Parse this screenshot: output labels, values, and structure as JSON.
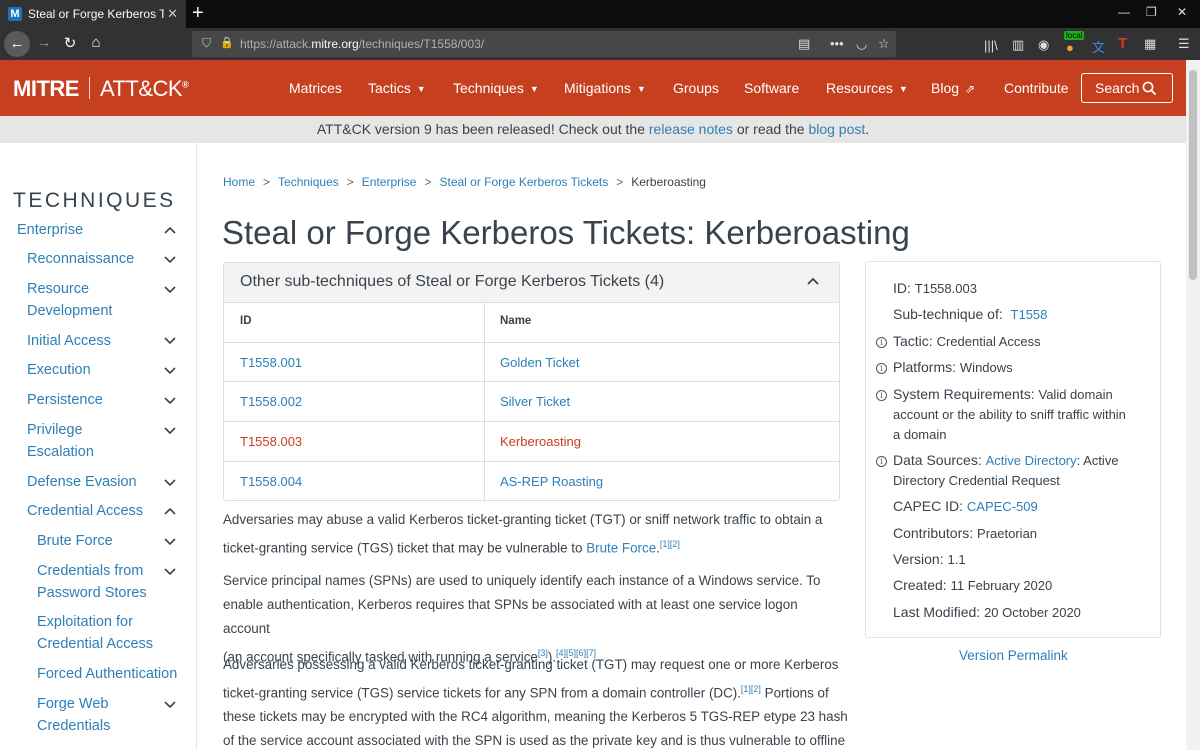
{
  "browser": {
    "tab_title": "Steal or Forge Kerberos Tickets",
    "tab_favicon": "M",
    "url_prefix": "https://attack.",
    "url_domain": "mitre.org",
    "url_path": "/techniques/T1558/003/",
    "local_badge": "local",
    "icons": [
      "back-icon",
      "forward-icon",
      "reload-icon",
      "home-icon",
      "shield-icon",
      "lock-icon",
      "reader-icon",
      "more-icon",
      "pocket-icon",
      "bookmark-star-icon",
      "library-icon",
      "sidebar-icon",
      "account-icon",
      "extension-icon",
      "translate-icon",
      "tab-icon",
      "grid-icon",
      "menu-icon"
    ]
  },
  "site": {
    "logo_mitre": "MITRE",
    "logo_attck": "ATT&CK",
    "logo_reg": "®",
    "nav": [
      {
        "label": "Matrices",
        "dropdown": false
      },
      {
        "label": "Tactics",
        "dropdown": true
      },
      {
        "label": "Techniques",
        "dropdown": true
      },
      {
        "label": "Mitigations",
        "dropdown": true
      },
      {
        "label": "Groups",
        "dropdown": false
      },
      {
        "label": "Software",
        "dropdown": false
      },
      {
        "label": "Resources",
        "dropdown": true
      },
      {
        "label": "Blog",
        "dropdown": false
      },
      {
        "label": "Contribute",
        "dropdown": false
      }
    ],
    "search_label": "Search",
    "header_color": "#c63f1f",
    "link_color": "#2e7fb8"
  },
  "banner": {
    "text_1": "ATT&CK version 9 has been released! Check out the ",
    "link_1": "release notes",
    "text_2": " or read the ",
    "link_2": "blog post",
    "text_3": "."
  },
  "sidebar": {
    "title": "TECHNIQUES",
    "items": [
      {
        "label": "Enterprise",
        "expanded": true
      },
      {
        "label": "Reconnaissance",
        "expanded": false
      },
      {
        "label": "Resource Development",
        "expanded": false
      },
      {
        "label": "Initial Access",
        "expanded": false
      },
      {
        "label": "Execution",
        "expanded": false
      },
      {
        "label": "Persistence",
        "expanded": false
      },
      {
        "label": "Privilege Escalation",
        "expanded": false
      },
      {
        "label": "Defense Evasion",
        "expanded": false
      },
      {
        "label": "Credential Access",
        "expanded": true
      },
      {
        "label": "Brute Force",
        "expanded": false
      },
      {
        "label": "Credentials from Password Stores",
        "expanded": false
      },
      {
        "label": "Exploitation for Credential Access"
      },
      {
        "label": "Forced Authentication"
      },
      {
        "label": "Forge Web Credentials",
        "expanded": false
      }
    ]
  },
  "breadcrumb": [
    "Home",
    "Techniques",
    "Enterprise",
    "Steal or Forge Kerberos Tickets",
    "Kerberoasting"
  ],
  "breadcrumb_sep": ">",
  "page_title": "Steal or Forge Kerberos Tickets: Kerberoasting",
  "subtechniques": {
    "heading": "Other sub-techniques of Steal or Forge Kerberos Tickets (4)",
    "col_id": "ID",
    "col_name": "Name",
    "rows": [
      {
        "id": "T1558.001",
        "name": "Golden Ticket",
        "active": false
      },
      {
        "id": "T1558.002",
        "name": "Silver Ticket",
        "active": false
      },
      {
        "id": "T1558.003",
        "name": "Kerberoasting",
        "active": true
      },
      {
        "id": "T1558.004",
        "name": "AS-REP Roasting",
        "active": false
      }
    ]
  },
  "description": {
    "p1_l1": "Adversaries may abuse a valid Kerberos ticket-granting ticket (TGT) or sniff network traffic to obtain a",
    "p1_l2": "ticket-granting service (TGS) ticket that may be vulnerable to ",
    "p1_link": "Brute Force",
    "p1_end": ".",
    "p1_refs": "[1][2]",
    "p2_l1": "Service principal names (SPNs) are used to uniquely identify each instance of a Windows service. To",
    "p2_l2": "enable authentication, Kerberos requires that SPNs be associated with at least one service logon account",
    "p2_l3": "(an account specifically tasked with running a service",
    "p2_ref_a": "[3]",
    "p2_mid": ").",
    "p2_ref_b": "[4][5][6][7]",
    "p3_l1": "Adversaries possessing a valid Kerberos ticket-granting ticket (TGT) may request one or more Kerberos",
    "p3_l2a": "ticket-granting service (TGS) service tickets for any SPN from a domain controller (DC).",
    "p3_ref": "[1][2]",
    "p3_l2b": " Portions of",
    "p3_l3": "these tickets may be encrypted with the RC4 algorithm, meaning the Kerberos 5 TGS-REP etype 23 hash",
    "p3_l4": "of the service account associated with the SPN is used as the private key and is thus vulnerable to offline"
  },
  "info": {
    "id_k": "ID:",
    "id_v": "T1558.003",
    "sub_k": "Sub-technique of:",
    "sub_v": "T1558",
    "tactic_k": "Tactic:",
    "tactic_v": "Credential Access",
    "platforms_k": "Platforms:",
    "platforms_v": "Windows",
    "sysreq_k": "System Requirements:",
    "sysreq_l1": "Valid domain",
    "sysreq_l2": "account or the ability to sniff traffic within",
    "sysreq_l3": "a domain",
    "ds_k": "Data Sources:",
    "ds_link": "Active Directory",
    "ds_rest": ": Active",
    "ds_l2": "Directory Credential Request",
    "capec_k": "CAPEC ID:",
    "capec_v": "CAPEC-509",
    "contrib_k": "Contributors:",
    "contrib_v": "Praetorian",
    "version_k": "Version:",
    "version_v": "1.1",
    "created_k": "Created:",
    "created_v": "11 February 2020",
    "modified_k": "Last Modified:",
    "modified_v": "20 October 2020",
    "info_icon": "i"
  },
  "permalink": "Version Permalink"
}
